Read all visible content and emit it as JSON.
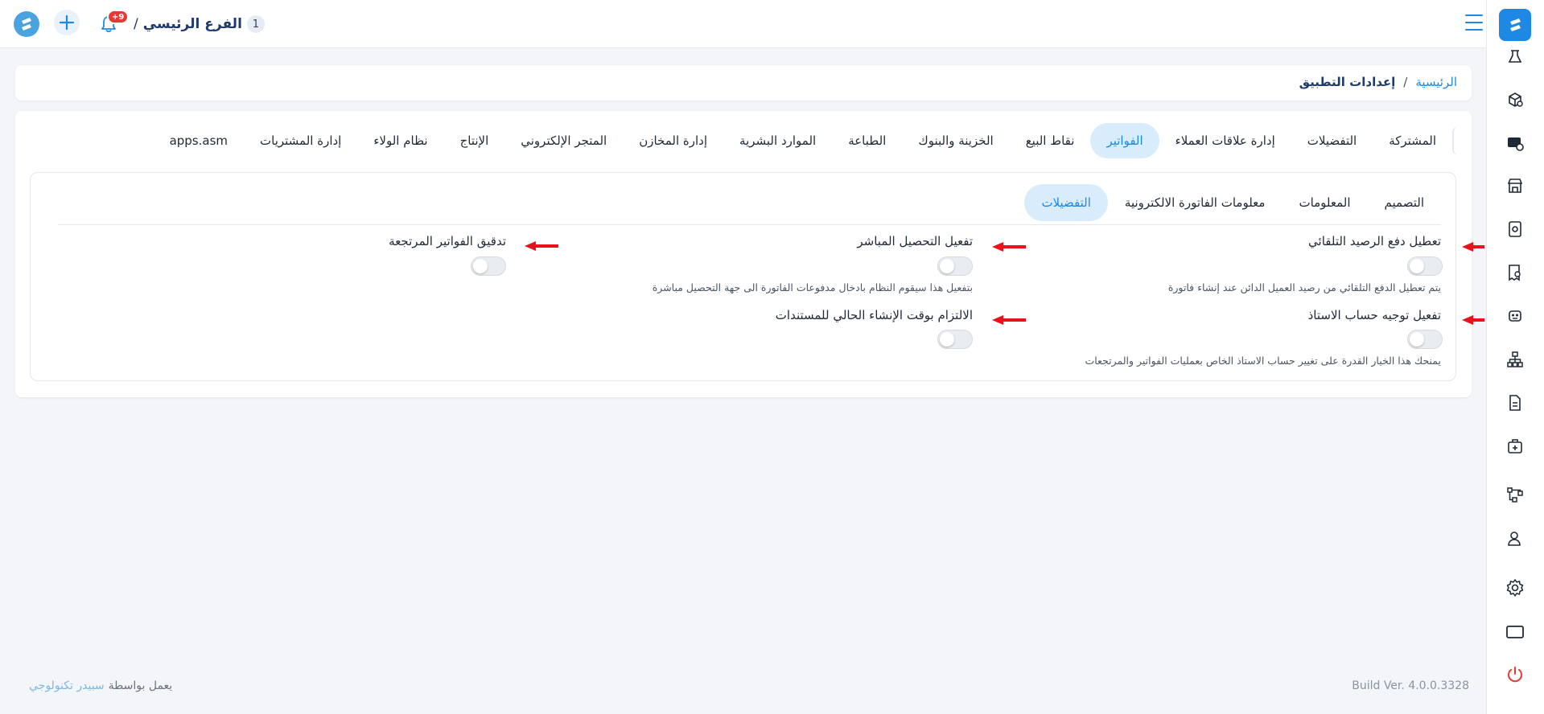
{
  "header": {
    "branch_number": "1",
    "branch_name": "الفرع الرئيسي",
    "branch_separator": "/",
    "notification_count": "+9"
  },
  "breadcrumb": {
    "home": "الرئيسية",
    "separator": "/",
    "current": "إعدادات التطبيق"
  },
  "tabs": [
    {
      "label": "المشتركة",
      "active": false
    },
    {
      "label": "التفضيلات",
      "active": false
    },
    {
      "label": "إدارة علاقات العملاء",
      "active": false
    },
    {
      "label": "الفواتير",
      "active": true
    },
    {
      "label": "نقاط البيع",
      "active": false
    },
    {
      "label": "الخزينة والبنوك",
      "active": false
    },
    {
      "label": "الطباعة",
      "active": false
    },
    {
      "label": "الموارد البشرية",
      "active": false
    },
    {
      "label": "إدارة المخازن",
      "active": false
    },
    {
      "label": "المتجر الإلكتروني",
      "active": false
    },
    {
      "label": "الإنتاج",
      "active": false
    },
    {
      "label": "نظام الولاء",
      "active": false
    },
    {
      "label": "إدارة المشتريات",
      "active": false
    },
    {
      "label": "apps.asm",
      "active": false
    }
  ],
  "subtabs": [
    {
      "label": "التصميم",
      "active": false
    },
    {
      "label": "المعلومات",
      "active": false
    },
    {
      "label": "معلومات الفاتورة الالكترونية",
      "active": false
    },
    {
      "label": "التفضيلات",
      "active": true
    }
  ],
  "settings": {
    "disable_auto_balance": {
      "label": "تعطيل دفع الرصيد التلقائي",
      "enabled": false,
      "description": "يتم تعطيل الدفع التلقائي من رصيد العميل الدائن عند إنشاء فاتورة"
    },
    "direct_collection": {
      "label": "تفعيل التحصيل المباشر",
      "enabled": false,
      "description": "بتفعيل هذا سيقوم النظام بادخال مدفوعات الفاتورة الى جهة التحصيل مباشرة"
    },
    "returned_invoices_audit": {
      "label": "تدقيق الفواتير المرتجعة",
      "enabled": false
    },
    "ledger_account_routing": {
      "label": "تفعيل توجيه حساب الاستاذ",
      "enabled": false,
      "description": "يمنحك هذا الخيار القدرة على تغيير حساب الاستاذ الخاص بعمليات الفواتير والمرتجعات"
    },
    "current_creation_time": {
      "label": "الالتزام بوقت الإنشاء الحالي للمستندات",
      "enabled": false
    }
  },
  "footer": {
    "powered_by": "يعمل بواسطة",
    "company": "سبيدر تكنولوجي",
    "build_version": "Build Ver. 4.0.0.3328"
  },
  "colors": {
    "primary": "#1e88e5",
    "active_tab_bg": "#d9ecfb",
    "arrow": "#e8121b",
    "badge": "#e53935"
  },
  "sidebar_icons": [
    "app-logo-icon",
    "flask-icon",
    "cube-settings-icon",
    "card-gear-icon",
    "store-icon",
    "document-eye-icon",
    "receipt-search-icon",
    "robot-icon",
    "hierarchy-icon",
    "invoice-icon",
    "medical-bag-icon",
    "workflow-icon",
    "user-settings-icon",
    "gear-icon",
    "window-icon",
    "power-icon"
  ]
}
